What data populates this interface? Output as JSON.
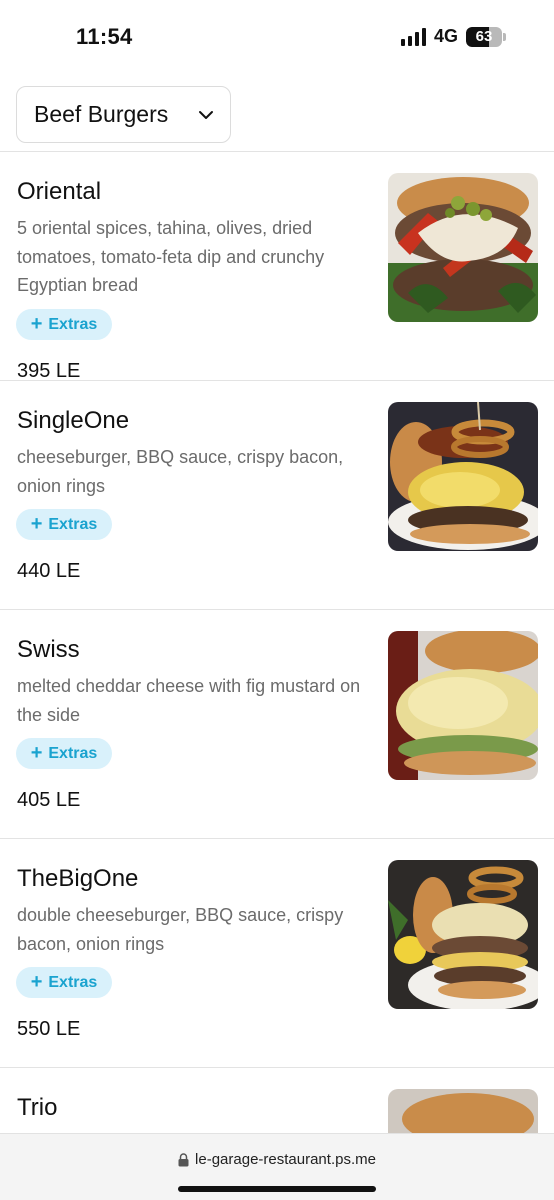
{
  "status_bar": {
    "time": "11:54",
    "network": "4G",
    "battery": "63",
    "battery_level": 0.63
  },
  "category": {
    "label": "Beef Burgers",
    "icon": "chevron-down-icon"
  },
  "items": [
    {
      "name": "Oriental",
      "description": "5 oriental spices, tahina, olives, dried tomatoes,  tomato-feta dip and crunchy Egyptian bread",
      "extras_label": "Extras",
      "price": "395 LE"
    },
    {
      "name": "SingleOne",
      "description": "cheeseburger, BBQ sauce, crispy bacon, onion rings",
      "extras_label": "Extras",
      "price": "440 LE"
    },
    {
      "name": "Swiss",
      "description": "melted cheddar cheese with fig mustard on the side",
      "extras_label": "Extras",
      "price": "405 LE"
    },
    {
      "name": "TheBigOne",
      "description": "double cheeseburger, BBQ sauce, crispy bacon, onion rings",
      "extras_label": "Extras",
      "price": "550 LE"
    },
    {
      "name": "Trio"
    }
  ],
  "browser": {
    "url": "le-garage-restaurant.ps.me",
    "icon": "lock-icon"
  }
}
